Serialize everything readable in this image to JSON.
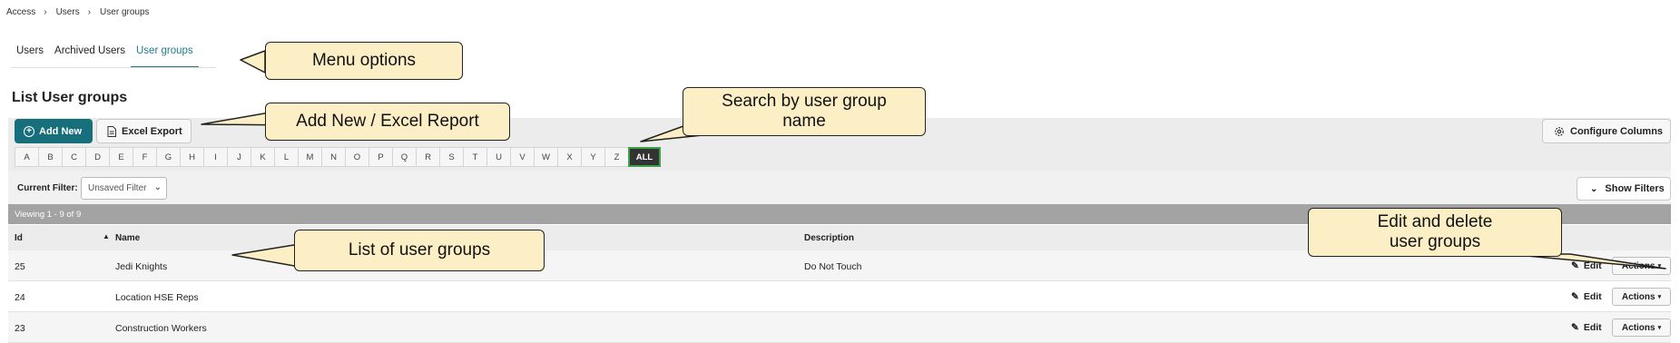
{
  "breadcrumb": [
    "Access",
    "Users",
    "User groups"
  ],
  "tabs": [
    {
      "label": "Users",
      "active": false
    },
    {
      "label": "Archived Users",
      "active": false
    },
    {
      "label": "User groups",
      "active": true
    }
  ],
  "page_title": "List User groups",
  "toolbar": {
    "add_new": "Add New",
    "excel_export": "Excel Export",
    "configure_columns": "Configure Columns"
  },
  "letters": [
    "A",
    "B",
    "C",
    "D",
    "E",
    "F",
    "G",
    "H",
    "I",
    "J",
    "K",
    "L",
    "M",
    "N",
    "O",
    "P",
    "Q",
    "R",
    "S",
    "T",
    "U",
    "V",
    "W",
    "X",
    "Y",
    "Z",
    "ALL"
  ],
  "active_letter": "ALL",
  "filter": {
    "label": "Current Filter:",
    "value": "Unsaved Filter",
    "show_filters": "Show Filters"
  },
  "viewing": "Viewing 1 - 9 of 9",
  "table": {
    "headers": {
      "id": "Id",
      "name": "Name",
      "description": "Description"
    },
    "rows": [
      {
        "id": "25",
        "name": "Jedi Knights",
        "description": "Do Not Touch",
        "edit": "Edit",
        "actions": "Actions"
      },
      {
        "id": "24",
        "name": "Location HSE Reps",
        "description": "",
        "edit": "Edit",
        "actions": "Actions"
      },
      {
        "id": "23",
        "name": "Construction Workers",
        "description": "",
        "edit": "Edit",
        "actions": "Actions"
      }
    ]
  },
  "callouts": {
    "menu_options": "Menu options",
    "add_new_excel": "Add New / Excel Report",
    "search_line1": "Search by user group",
    "search_line2": "name",
    "list_user_groups": "List of user groups",
    "edit_delete_line1": "Edit and delete",
    "edit_delete_line2": "user groups"
  },
  "colors": {
    "accent": "#176f7b",
    "active_tab": "#1f7c8c",
    "callout_fill": "#fdefc5",
    "all_letter_border": "#3ea14a"
  }
}
